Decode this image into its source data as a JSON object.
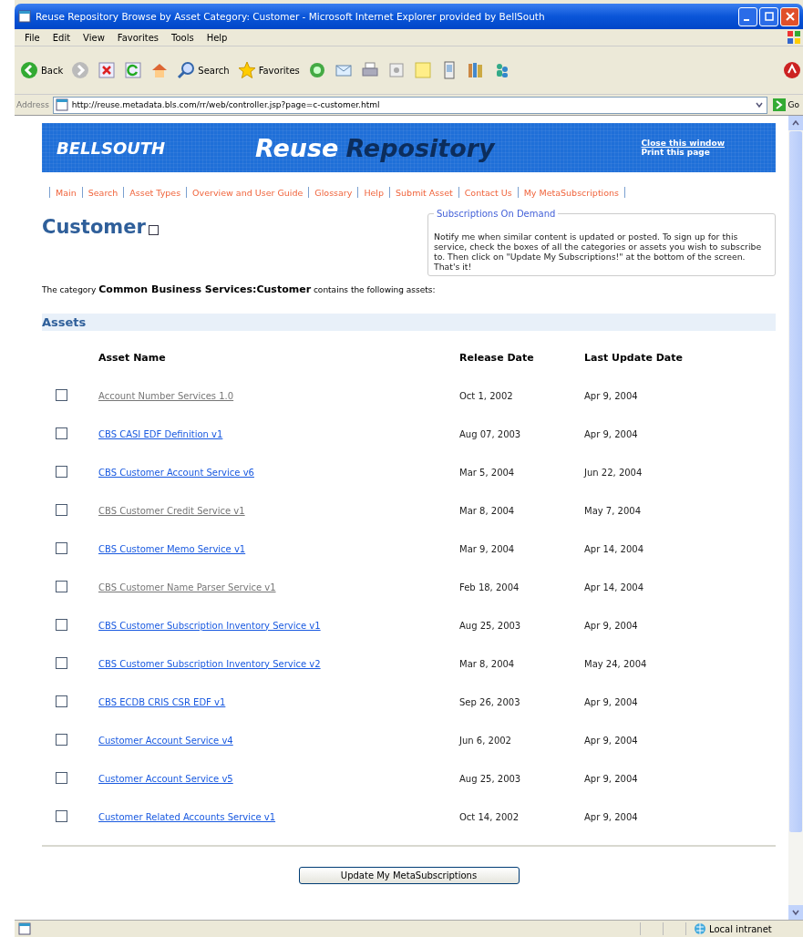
{
  "window": {
    "title": "Reuse Repository Browse by Asset Category: Customer - Microsoft Internet Explorer provided by BellSouth"
  },
  "menu": [
    "File",
    "Edit",
    "View",
    "Favorites",
    "Tools",
    "Help"
  ],
  "toolbar": {
    "back": "Back",
    "search": "Search",
    "favorites": "Favorites"
  },
  "address": {
    "label": "Address",
    "url": "http://reuse.metadata.bls.com/rr/web/controller.jsp?page=c-customer.html",
    "go": "Go"
  },
  "banner": {
    "logo": "BELLSOUTH",
    "title_1": "Reuse",
    "title_2": "Repository",
    "links": [
      "Close this window",
      "Print this page"
    ]
  },
  "nav": [
    "Main",
    "Search",
    "Asset Types",
    "Overview and User Guide",
    "Glossary",
    "Help",
    "Submit Asset",
    "Contact Us",
    "My MetaSubscriptions"
  ],
  "heading": "Customer",
  "heading_checkbox": {
    "checked": false
  },
  "subscriptions": {
    "title": "Subscriptions On Demand",
    "text": "Notify me when similar content is updated or posted. To sign up for this service, check the boxes of all the categories or assets you wish to subscribe to. Then click on \"Update My Subscriptions!\" at the bottom of the screen. That's it!"
  },
  "category_sentence": "The category **Common Business Services:Customer** contains the following assets:",
  "assets": {
    "title": "Assets",
    "columns": [
      "Asset Name",
      "Release Date",
      "Last Update Date"
    ],
    "rows": [
      {
        "name": "Account Number Services 1.0",
        "release": "Oct 1, 2002",
        "updated": "Apr 9, 2004",
        "checked": false,
        "visited": true
      },
      {
        "name": "CBS CASI EDF Definition v1",
        "release": "Aug 07, 2003",
        "updated": "Apr 9, 2004",
        "checked": false,
        "visited": false
      },
      {
        "name": "CBS Customer Account Service v6",
        "release": "Mar 5, 2004",
        "updated": "Jun 22, 2004",
        "checked": false,
        "visited": false
      },
      {
        "name": "CBS Customer Credit Service v1",
        "release": "Mar 8, 2004",
        "updated": "May 7, 2004",
        "checked": false,
        "visited": true
      },
      {
        "name": "CBS Customer Memo Service v1",
        "release": "Mar 9, 2004",
        "updated": "Apr 14, 2004",
        "checked": false,
        "visited": false
      },
      {
        "name": "CBS Customer Name Parser Service v1",
        "release": "Feb 18, 2004",
        "updated": "Apr 14, 2004",
        "checked": false,
        "visited": true
      },
      {
        "name": "CBS Customer Subscription Inventory Service v1",
        "release": "Aug 25, 2003",
        "updated": "Apr 9, 2004",
        "checked": false,
        "visited": false
      },
      {
        "name": "CBS Customer Subscription Inventory Service v2",
        "release": "Mar 8, 2004",
        "updated": "May 24, 2004",
        "checked": false,
        "visited": false
      },
      {
        "name": "CBS ECDB CRIS CSR EDF v1",
        "release": "Sep 26, 2003",
        "updated": "Apr 9, 2004",
        "checked": false,
        "visited": false
      },
      {
        "name": "Customer Account Service v4",
        "release": "Jun 6, 2002",
        "updated": "Apr 9, 2004",
        "checked": false,
        "visited": false
      },
      {
        "name": "Customer Account Service v5",
        "release": "Aug 25, 2003",
        "updated": "Apr 9, 2004",
        "checked": false,
        "visited": false
      },
      {
        "name": "Customer Related Accounts Service v1",
        "release": "Oct 14, 2002",
        "updated": "Apr 9, 2004",
        "checked": false,
        "visited": false
      }
    ]
  },
  "update_button": "Update My MetaSubscriptions",
  "status_bar": {
    "zone": "Local intranet"
  }
}
